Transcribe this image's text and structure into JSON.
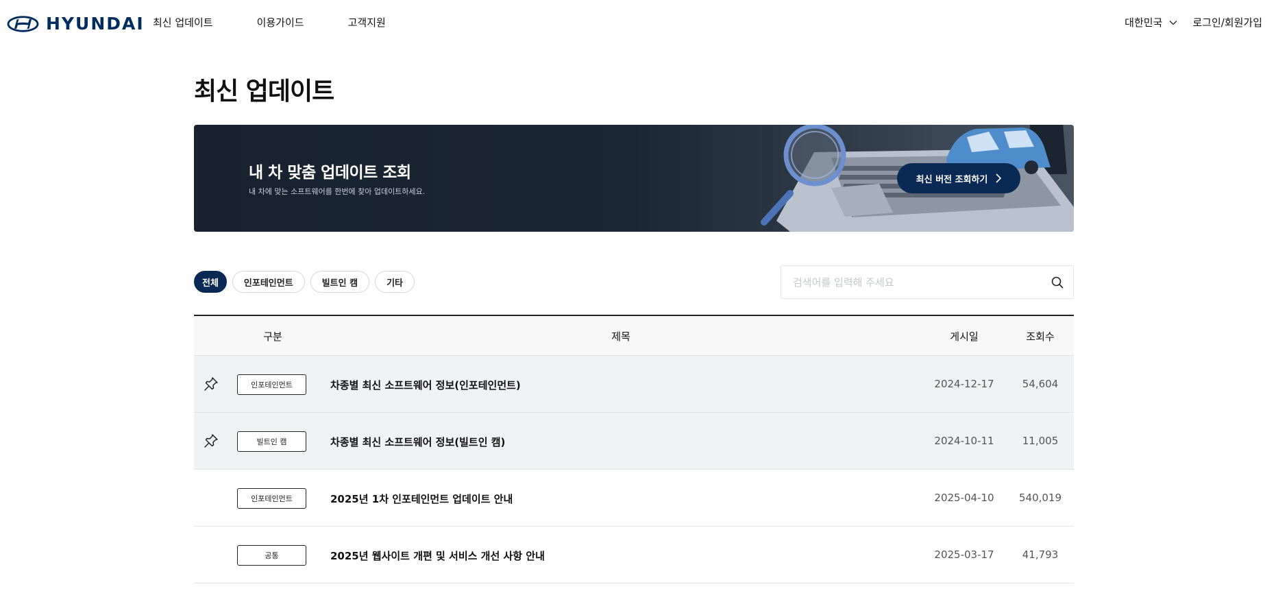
{
  "header": {
    "brand": "HYUNDAI",
    "nav": [
      {
        "label": "최신 업데이트"
      },
      {
        "label": "이용가이드"
      },
      {
        "label": "고객지원"
      }
    ],
    "region": "대한민국",
    "login": "로그인/회원가입"
  },
  "page": {
    "title": "최신 업데이트"
  },
  "banner": {
    "title": "내 차 맞춤 업데이트 조회",
    "description": "내 차에 맞는 소프트웨어를 한번에 찾아 업데이트하세요.",
    "cta": "최신 버전 조회하기"
  },
  "filters": [
    {
      "label": "전체",
      "active": true
    },
    {
      "label": "인포테인먼트",
      "active": false
    },
    {
      "label": "빌트인 캠",
      "active": false
    },
    {
      "label": "기타",
      "active": false
    }
  ],
  "search": {
    "placeholder": "검색어를 입력해 주세요",
    "value": ""
  },
  "table": {
    "columns": {
      "category": "구분",
      "title": "제목",
      "date": "게시일",
      "views": "조회수"
    },
    "rows": [
      {
        "pinned": true,
        "category": "인포테인먼트",
        "title": "차종별 최신 소프트웨어 정보(인포테인먼트)",
        "date": "2024-12-17",
        "views": "54,604"
      },
      {
        "pinned": true,
        "category": "빌트인 캠",
        "title": "차종별 최신 소프트웨어 정보(빌트인 캠)",
        "date": "2024-10-11",
        "views": "11,005"
      },
      {
        "pinned": false,
        "category": "인포테인먼트",
        "title": "2025년 1차 인포테인먼트 업데이트 안내",
        "date": "2025-04-10",
        "views": "540,019"
      },
      {
        "pinned": false,
        "category": "공통",
        "title": "2025년 웹사이트 개편 및 서비스 개선 사항 안내",
        "date": "2025-03-17",
        "views": "41,793"
      }
    ]
  },
  "colors": {
    "brand": "#002c5f",
    "active": "#0a2a55",
    "banner": "#17222e",
    "pinnedRow": "#f1f2f4"
  },
  "icons": {
    "logo": "hyundai-logo-icon",
    "region": "chevron-down-icon",
    "cta": "chevron-right-icon",
    "search": "search-icon",
    "pin": "pin-icon"
  }
}
